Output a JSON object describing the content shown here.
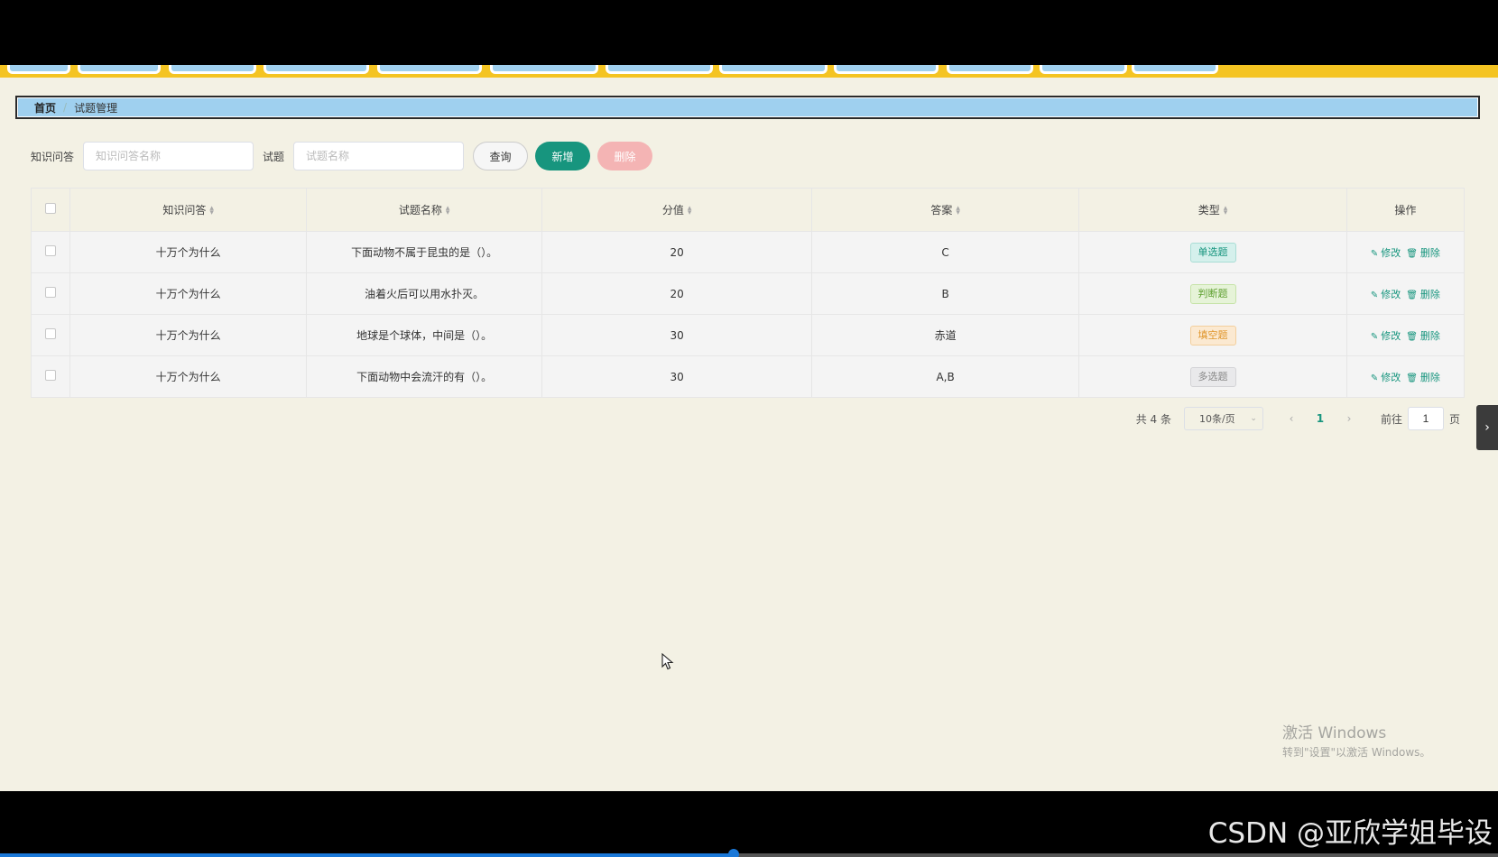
{
  "breadcrumb": {
    "home": "首页",
    "separator": "/",
    "current": "试题管理"
  },
  "search": {
    "label1": "知识问答",
    "placeholder1": "知识问答名称",
    "label2": "试题",
    "placeholder2": "试题名称",
    "query_label": "查询",
    "add_label": "新增",
    "delete_label": "删除"
  },
  "table": {
    "headers": [
      "知识问答",
      "试题名称",
      "分值",
      "答案",
      "类型",
      "操作"
    ],
    "rows": [
      {
        "topic": "十万个为什么",
        "name": "下面动物不属于昆虫的是（）。",
        "score": "20",
        "answer": "C",
        "type": "单选题"
      },
      {
        "topic": "十万个为什么",
        "name": "油着火后可以用水扑灭。",
        "score": "20",
        "answer": "B",
        "type": "判断题"
      },
      {
        "topic": "十万个为什么",
        "name": "地球是个球体，中间是（）。",
        "score": "30",
        "answer": "赤道",
        "type": "填空题"
      },
      {
        "topic": "十万个为什么",
        "name": "下面动物中会流汗的有（）。",
        "score": "30",
        "answer": "A,B",
        "type": "多选题"
      }
    ],
    "edit_label": "修改",
    "delete_label": "删除"
  },
  "pagination": {
    "total": "共 4 条",
    "page_size": "10条/页",
    "current_page": "1",
    "goto_label": "前往",
    "goto_value": "1",
    "page_suffix": "页"
  },
  "watermark": {
    "line1": "激活 Windows",
    "line2": "转到\"设置\"以激活 Windows。"
  },
  "footer": {
    "credit": "CSDN @亚欣学姐毕设"
  },
  "video": {
    "progress": 0.49
  },
  "icons": {
    "sort": "sort-caret-icon",
    "edit": "edit-icon",
    "delete": "trash-icon",
    "prev": "chevron-left-icon",
    "next": "chevron-right-icon",
    "side": "chevron-right-icon"
  },
  "colors": {
    "accent": "#17957e",
    "nav_bar": "#f4c422",
    "tab": "#9fd0ef",
    "danger_light": "#f4b4b4"
  }
}
